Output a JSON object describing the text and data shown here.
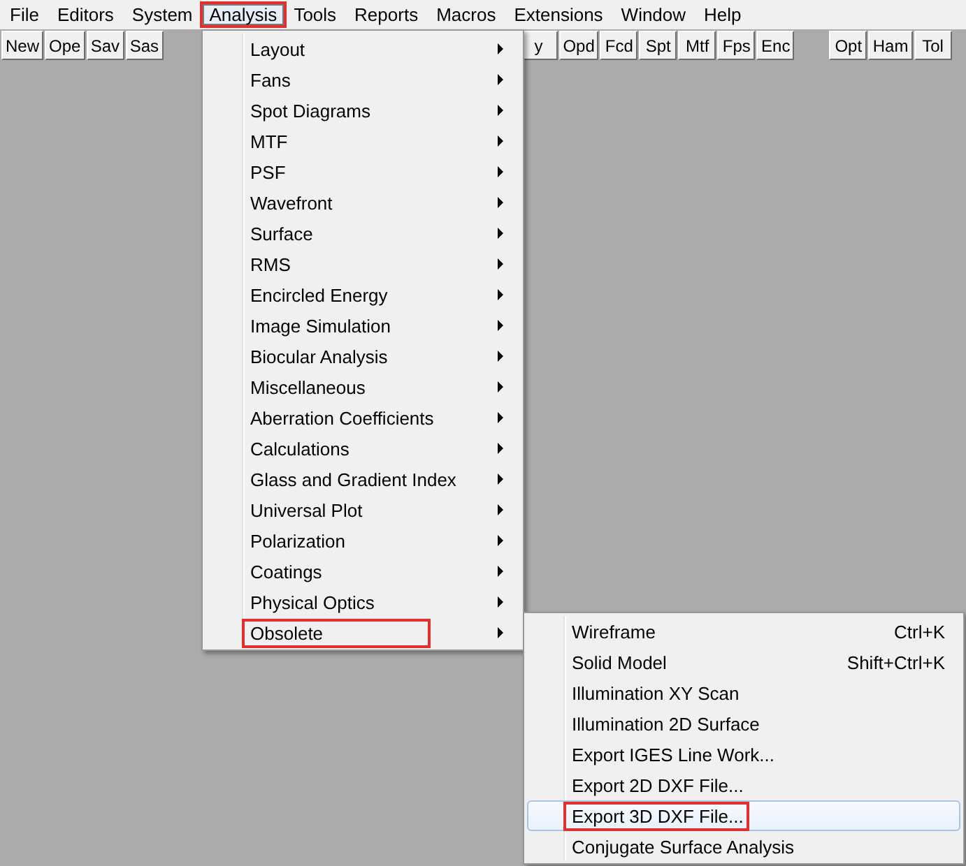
{
  "menubar": [
    {
      "label": "File",
      "open": false
    },
    {
      "label": "Editors",
      "open": false
    },
    {
      "label": "System",
      "open": false
    },
    {
      "label": "Analysis",
      "open": true
    },
    {
      "label": "Tools",
      "open": false
    },
    {
      "label": "Reports",
      "open": false
    },
    {
      "label": "Macros",
      "open": false
    },
    {
      "label": "Extensions",
      "open": false
    },
    {
      "label": "Window",
      "open": false
    },
    {
      "label": "Help",
      "open": false
    }
  ],
  "toolbar": {
    "groups": [
      [
        "New",
        "Ope",
        "Sav",
        "Sas"
      ],
      [
        "y",
        "Opd",
        "Fcd",
        "Spt",
        "Mtf",
        "Fps",
        "Enc"
      ],
      [
        "Opt",
        "Ham",
        "Tol"
      ]
    ]
  },
  "analysis_menu": {
    "items": [
      {
        "label": "Layout",
        "submenu": true,
        "selected": false
      },
      {
        "label": "Fans",
        "submenu": true,
        "selected": false
      },
      {
        "label": "Spot Diagrams",
        "submenu": true,
        "selected": false
      },
      {
        "label": "MTF",
        "submenu": true,
        "selected": false
      },
      {
        "label": "PSF",
        "submenu": true,
        "selected": false
      },
      {
        "label": "Wavefront",
        "submenu": true,
        "selected": false
      },
      {
        "label": "Surface",
        "submenu": true,
        "selected": false
      },
      {
        "label": "RMS",
        "submenu": true,
        "selected": false
      },
      {
        "label": "Encircled Energy",
        "submenu": true,
        "selected": false
      },
      {
        "label": "Image Simulation",
        "submenu": true,
        "selected": false
      },
      {
        "label": "Biocular Analysis",
        "submenu": true,
        "selected": false
      },
      {
        "label": "Miscellaneous",
        "submenu": true,
        "selected": false
      },
      {
        "label": "Aberration Coefficients",
        "submenu": true,
        "selected": false
      },
      {
        "label": "Calculations",
        "submenu": true,
        "selected": false
      },
      {
        "label": "Glass and Gradient Index",
        "submenu": true,
        "selected": false
      },
      {
        "label": "Universal Plot",
        "submenu": true,
        "selected": false
      },
      {
        "label": "Polarization",
        "submenu": true,
        "selected": false
      },
      {
        "label": "Coatings",
        "submenu": true,
        "selected": false
      },
      {
        "label": "Physical Optics",
        "submenu": true,
        "selected": false
      },
      {
        "label": "Obsolete",
        "submenu": true,
        "selected": true
      }
    ]
  },
  "obsolete_menu": {
    "items": [
      {
        "label": "Wireframe",
        "shortcut": "Ctrl+K",
        "selected": false
      },
      {
        "label": "Solid Model",
        "shortcut": "Shift+Ctrl+K",
        "selected": false
      },
      {
        "label": "Illumination XY Scan",
        "selected": false
      },
      {
        "label": "Illumination 2D Surface",
        "selected": false
      },
      {
        "label": "Export IGES Line Work...",
        "selected": false
      },
      {
        "label": "Export 2D DXF File...",
        "selected": false
      },
      {
        "label": "Export 3D DXF File...",
        "selected": true
      },
      {
        "label": "Conjugate Surface Analysis",
        "selected": false
      }
    ]
  }
}
